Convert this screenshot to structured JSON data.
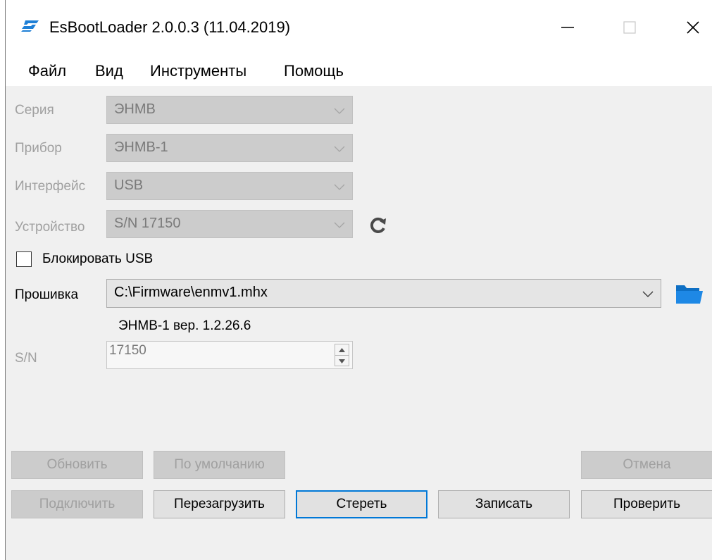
{
  "window": {
    "title": "EsBootLoader 2.0.0.3 (11.04.2019)",
    "icon": "app-logo-icon",
    "controls": [
      "minimize-icon",
      "maximize-icon",
      "close-icon"
    ]
  },
  "menu": {
    "file": "Файл",
    "view": "Вид",
    "tools": "Инструменты",
    "help": "Помощь"
  },
  "form": {
    "series": {
      "label": "Серия",
      "value": "ЭНМВ"
    },
    "device_model": {
      "label": "Прибор",
      "value": "ЭНМВ-1"
    },
    "interface": {
      "label": "Интерфейс",
      "value": "USB"
    },
    "device": {
      "label": "Устройство",
      "value": "S/N 17150"
    },
    "block_usb": {
      "label": "Блокировать USB",
      "checked": false
    },
    "firmware": {
      "label": "Прошивка",
      "value": "C:\\Firmware\\enmv1.mhx",
      "version": "ЭНМВ-1 вер. 1.2.26.6"
    },
    "sn": {
      "label": "S/N",
      "value": "17150"
    }
  },
  "buttons": {
    "update": "Обновить",
    "default": "По умолчанию",
    "cancel": "Отмена",
    "connect": "Подключить",
    "reboot": "Перезагрузить",
    "erase": "Стереть",
    "write": "Записать",
    "verify": "Проверить"
  },
  "colors": {
    "accent": "#0078d7",
    "folder": "#1e88e5",
    "logo": "#1e7fd6"
  }
}
